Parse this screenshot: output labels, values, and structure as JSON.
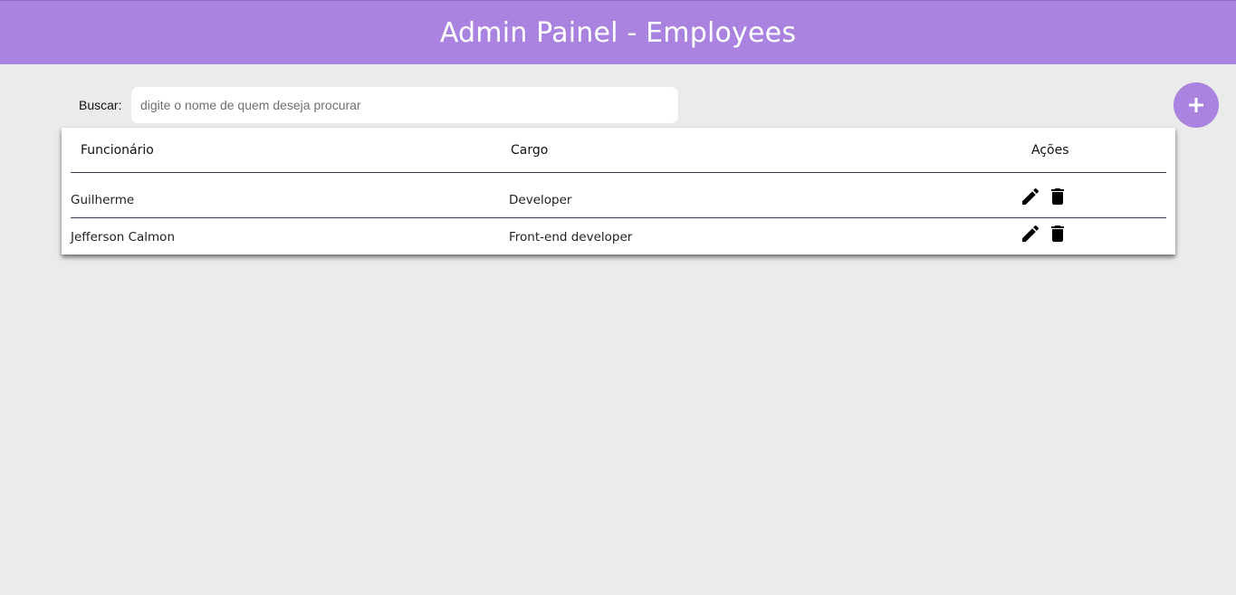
{
  "header": {
    "title": "Admin Painel - Employees"
  },
  "search": {
    "label": "Buscar:",
    "placeholder": "digite o nome de quem deseja procurar",
    "value": ""
  },
  "add_button": {
    "icon": "plus-icon",
    "symbol": "+"
  },
  "table": {
    "columns": [
      "Funcionário",
      "Cargo",
      "Ações"
    ],
    "rows": [
      {
        "name": "Guilherme",
        "role": "Developer",
        "actions": [
          "edit-icon",
          "delete-icon"
        ]
      },
      {
        "name": "Jefferson Calmon",
        "role": "Front-end developer",
        "actions": [
          "edit-icon",
          "delete-icon"
        ]
      }
    ]
  },
  "colors": {
    "accent": "#a983df",
    "background": "#ebebeb",
    "divider": "#3b3560"
  }
}
